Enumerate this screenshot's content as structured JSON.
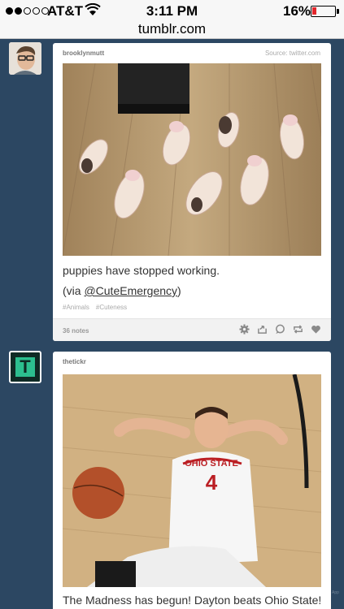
{
  "status_bar": {
    "carrier": "AT&T",
    "time": "3:11 PM",
    "battery_percent": "16%",
    "battery_level": 0.16
  },
  "browser": {
    "url": "tumblr.com"
  },
  "posts": [
    {
      "blog_name": "brooklynmutt",
      "source": "Source: twitter.com",
      "caption": "puppies have stopped working.",
      "via_prefix": "(via ",
      "via_link": "@CuteEmergency",
      "via_suffix": ")",
      "tags": [
        "#Animals",
        "#Cuteness"
      ],
      "notes": "36 notes"
    },
    {
      "blog_name": "thetickr",
      "avatar_letter": "T",
      "caption": "The Madness has begun! Dayton beats Ohio State!",
      "jersey_text": "OHIO STATE",
      "jersey_number": "4"
    }
  ],
  "watermark": "App",
  "colors": {
    "dashboard_bg": "#2c4762",
    "card_bg": "#ffffff",
    "battery_low": "#e3262b",
    "tickr_green": "#2cbf8f"
  }
}
